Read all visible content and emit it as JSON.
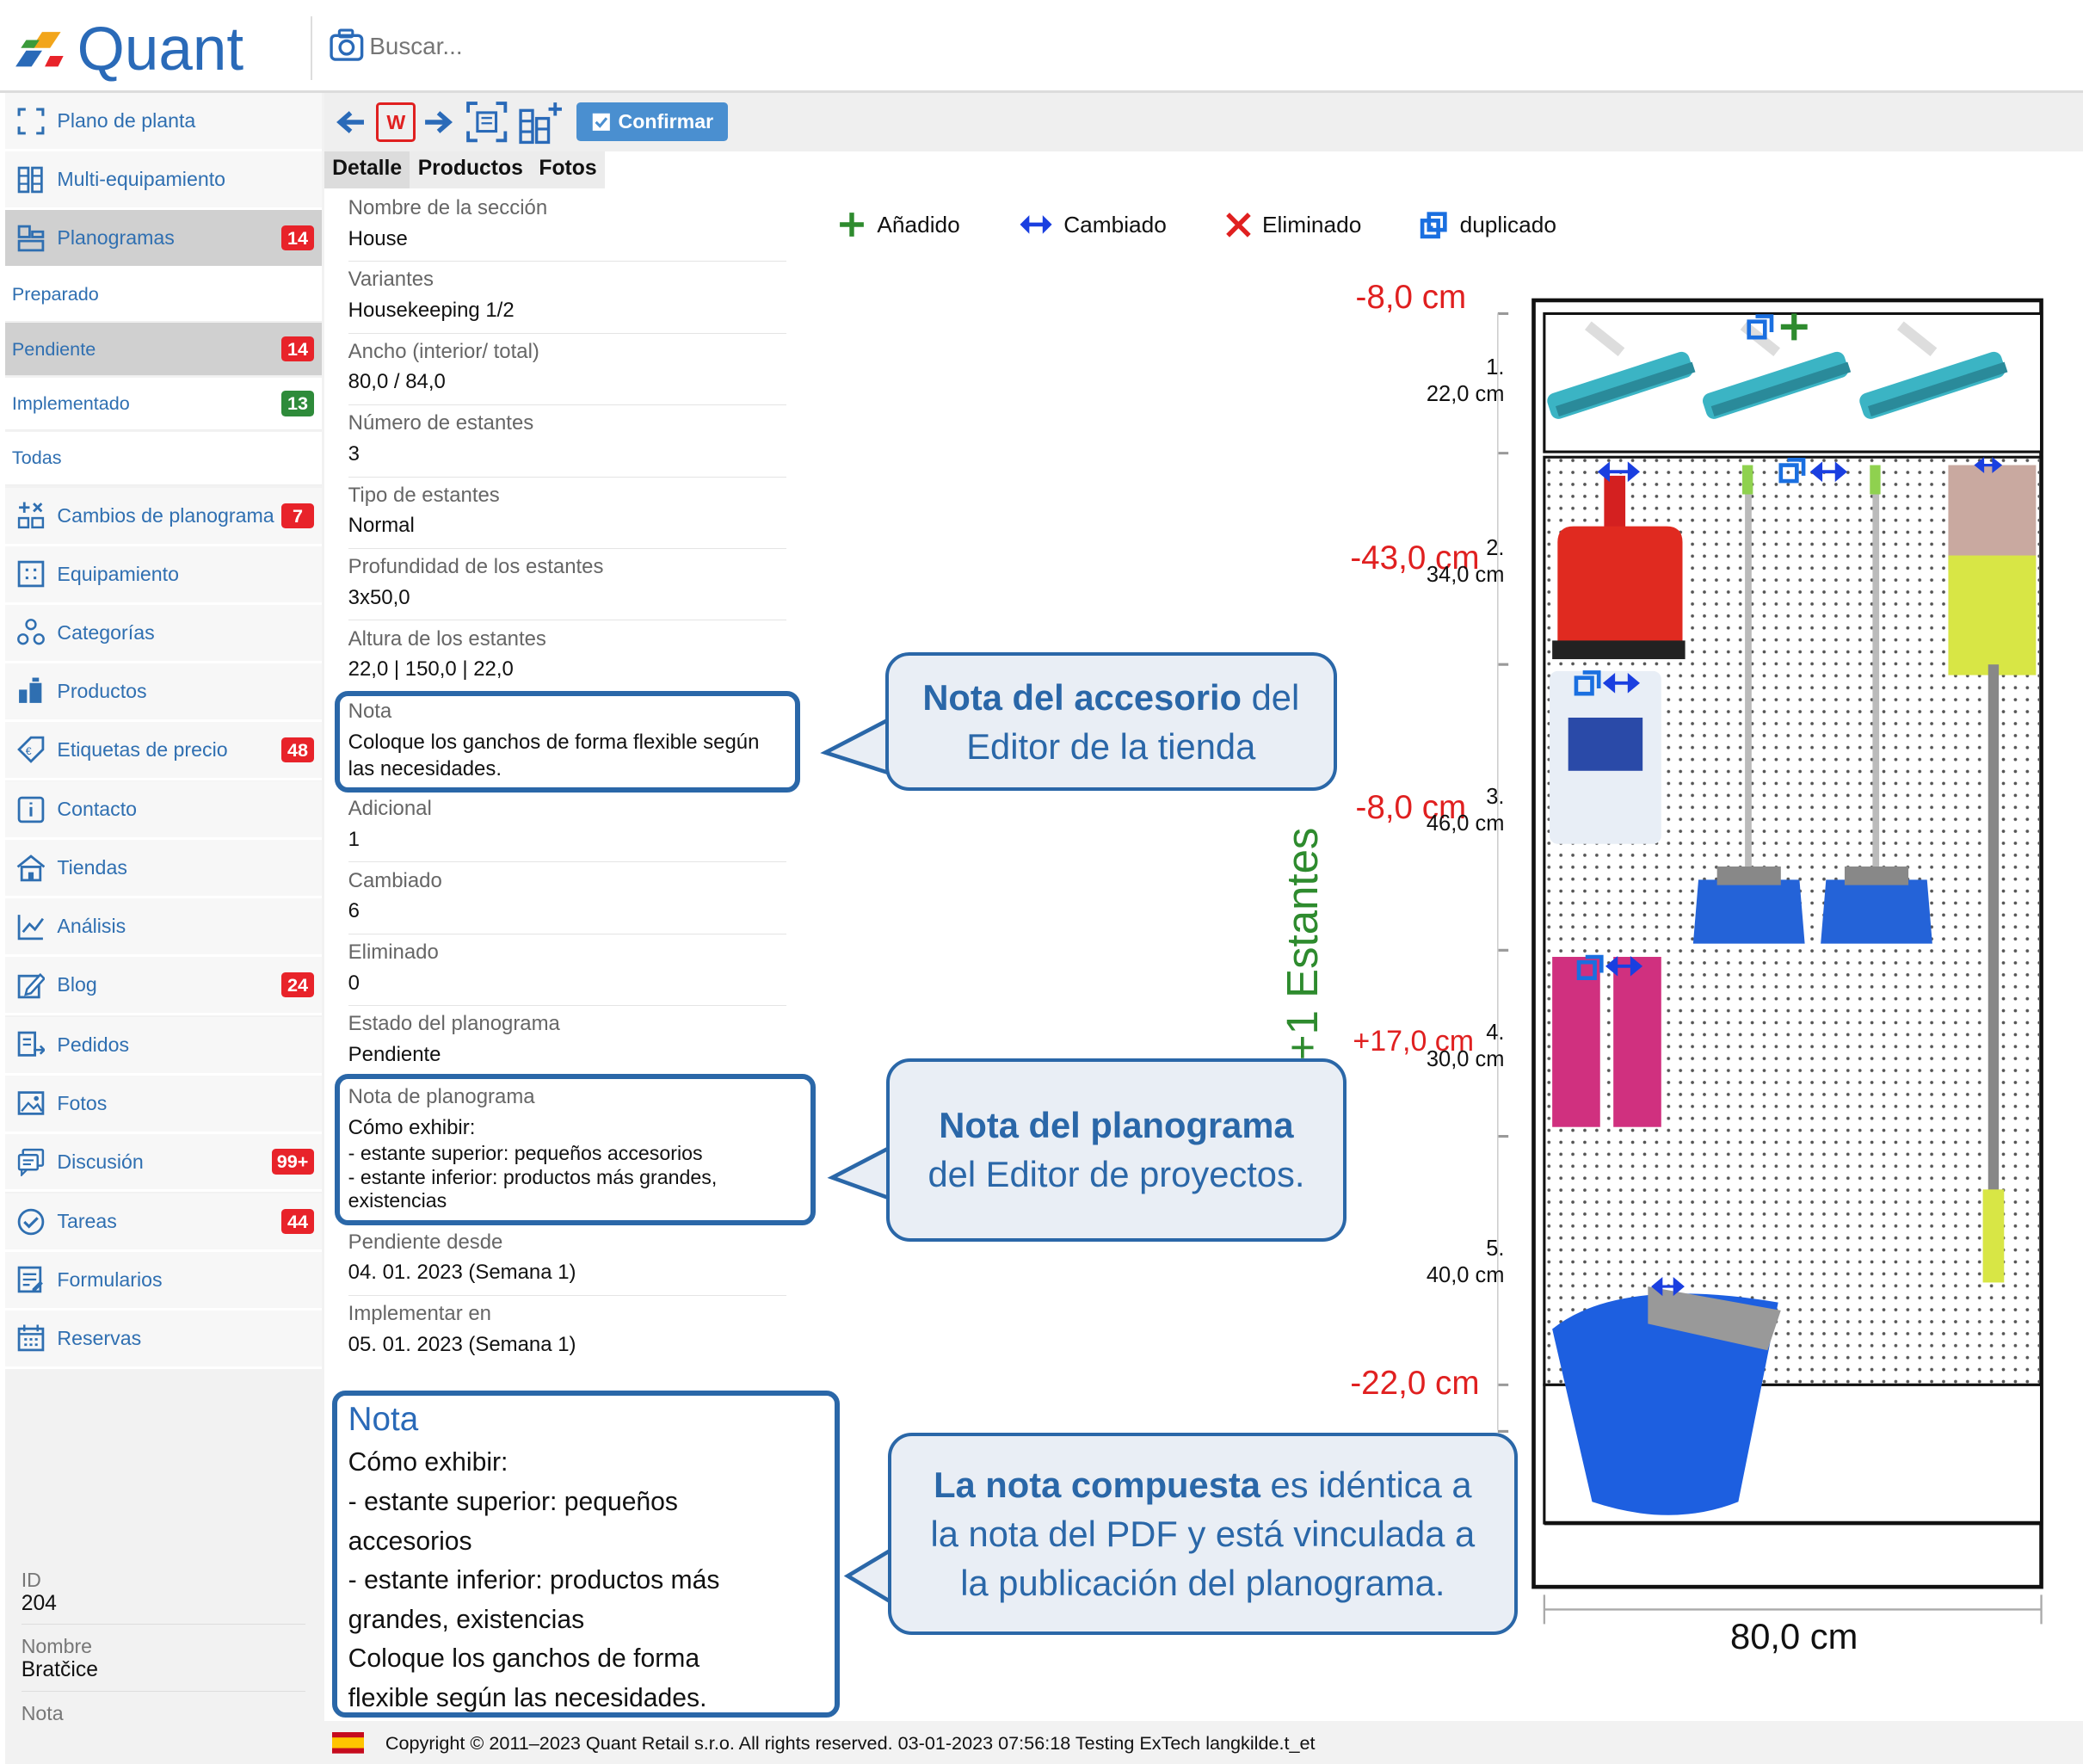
{
  "app": {
    "name": "Quant"
  },
  "search": {
    "placeholder": "Buscar..."
  },
  "toolbar": {
    "confirm_label": "Confirmar",
    "w_label": "W"
  },
  "tabs": [
    "Detalle",
    "Productos",
    "Fotos"
  ],
  "sidebar": {
    "items": [
      {
        "label": "Plano de planta",
        "icon": "floor-plan-icon"
      },
      {
        "label": "Multi-equipamiento",
        "icon": "multi-equipment-icon"
      },
      {
        "label": "Planogramas",
        "icon": "planogram-icon",
        "badge": "14"
      },
      {
        "label": "Cambios de planograma",
        "icon": "planogram-changes-icon",
        "badge": "7"
      },
      {
        "label": "Equipamiento",
        "icon": "equipment-icon"
      },
      {
        "label": "Categorías",
        "icon": "categories-icon"
      },
      {
        "label": "Productos",
        "icon": "products-icon"
      },
      {
        "label": "Etiquetas de precio",
        "icon": "price-tag-icon",
        "badge": "48"
      },
      {
        "label": "Contacto",
        "icon": "contact-icon"
      },
      {
        "label": "Tiendas",
        "icon": "stores-icon"
      },
      {
        "label": "Análisis",
        "icon": "analysis-icon"
      },
      {
        "label": "Blog",
        "icon": "blog-icon",
        "badge": "24"
      },
      {
        "label": "Pedidos",
        "icon": "orders-icon"
      },
      {
        "label": "Fotos",
        "icon": "photos-icon"
      },
      {
        "label": "Discusión",
        "icon": "discussion-icon",
        "badge": "99+"
      },
      {
        "label": "Tareas",
        "icon": "tasks-icon",
        "badge": "44"
      },
      {
        "label": "Formularios",
        "icon": "forms-icon"
      },
      {
        "label": "Reservas",
        "icon": "reservations-icon"
      }
    ],
    "subitems": [
      {
        "label": "Preparado"
      },
      {
        "label": "Pendiente",
        "badge": "14"
      },
      {
        "label": "Implementado",
        "badge": "13"
      },
      {
        "label": "Todas"
      }
    ],
    "info": [
      {
        "key": "ID",
        "value": "204"
      },
      {
        "key": "Nombre",
        "value": "Bratčice"
      },
      {
        "key": "Nota",
        "value": ""
      }
    ]
  },
  "details": [
    {
      "key": "Nombre de la sección",
      "value": "House"
    },
    {
      "key": "Variantes",
      "value": "Housekeeping 1/2"
    },
    {
      "key": "Ancho (interior/ total)",
      "value": "80,0 / 84,0"
    },
    {
      "key": "Número de estantes",
      "value": "3"
    },
    {
      "key": "Tipo de estantes",
      "value": "Normal"
    },
    {
      "key": "Profundidad de los estantes",
      "value": "3x50,0"
    },
    {
      "key": "Altura de los estantes",
      "value": "22,0 | 150,0 | 22,0"
    },
    {
      "key": "Nota",
      "value": "Coloque los ganchos de forma flexible según las necesidades."
    },
    {
      "key": "Adicional",
      "value": "1"
    },
    {
      "key": "Cambiado",
      "value": "6"
    },
    {
      "key": "Eliminado",
      "value": "0"
    },
    {
      "key": "Estado del planograma",
      "value": "Pendiente"
    },
    {
      "key": "Nota de planograma",
      "lines": [
        "Cómo exhibir:",
        "- estante superior: pequeños accesorios",
        "- estante inferior: productos más grandes, existencias"
      ]
    },
    {
      "key": "Pendiente desde",
      "value": "04. 01. 2023 (Semana 1)"
    },
    {
      "key": "Implementar en",
      "value": "05. 01. 2023 (Semana 1)"
    }
  ],
  "composite_note": {
    "title": "Nota",
    "lines": [
      "Cómo exhibir:",
      "- estante superior: pequeños accesorios",
      "- estante inferior: productos más grandes, existencias",
      "Coloque los ganchos de forma flexible según las necesidades."
    ]
  },
  "legend": [
    {
      "label": "Añadido",
      "icon": "plus-icon",
      "color": "#2e8b2e"
    },
    {
      "label": "Cambiado",
      "icon": "double-arrow-icon",
      "color": "#1a3fe0"
    },
    {
      "label": "Eliminado",
      "icon": "cross-icon",
      "color": "#e02020"
    },
    {
      "label": "duplicado",
      "icon": "duplicate-icon",
      "color": "#1a6fe0"
    }
  ],
  "callouts": {
    "accessory": {
      "bold": "Nota del accesorio",
      "rest1": " del",
      "rest2": "Editor de la tienda"
    },
    "planogram": {
      "bold": "Nota del planograma",
      "rest2": "del Editor de proyectos."
    },
    "composite": {
      "bold": "La nota compuesta",
      "rest1": " es idéntica a",
      "rest2": "la nota del PDF y está vinculada a",
      "rest3": "la publicación del planograma."
    }
  },
  "planogram": {
    "deltas": [
      "-8,0 cm",
      "-43,0 cm",
      "-8,0 cm",
      "+17,0 cm",
      "-22,0 cm"
    ],
    "shelves": [
      {
        "num": "1.",
        "height": "22,0 cm"
      },
      {
        "num": "2.",
        "height": "34,0 cm"
      },
      {
        "num": "3.",
        "height": "46,0 cm"
      },
      {
        "num": "4.",
        "height": "30,0 cm"
      },
      {
        "num": "5.",
        "height": "40,0 cm"
      }
    ],
    "vertical_label": "+1 Estantes",
    "width_label": "80,0 cm",
    "colors": {
      "green": "#2e8b2e",
      "red": "#e02020",
      "blue": "#1a3fe0"
    }
  },
  "footer": {
    "text": "Copyright © 2011–2023 Quant Retail s.r.o. All rights reserved. 03-01-2023 07:56:18  Testing ExTech  langkilde.t_et",
    "flag": "spain-flag-icon"
  }
}
